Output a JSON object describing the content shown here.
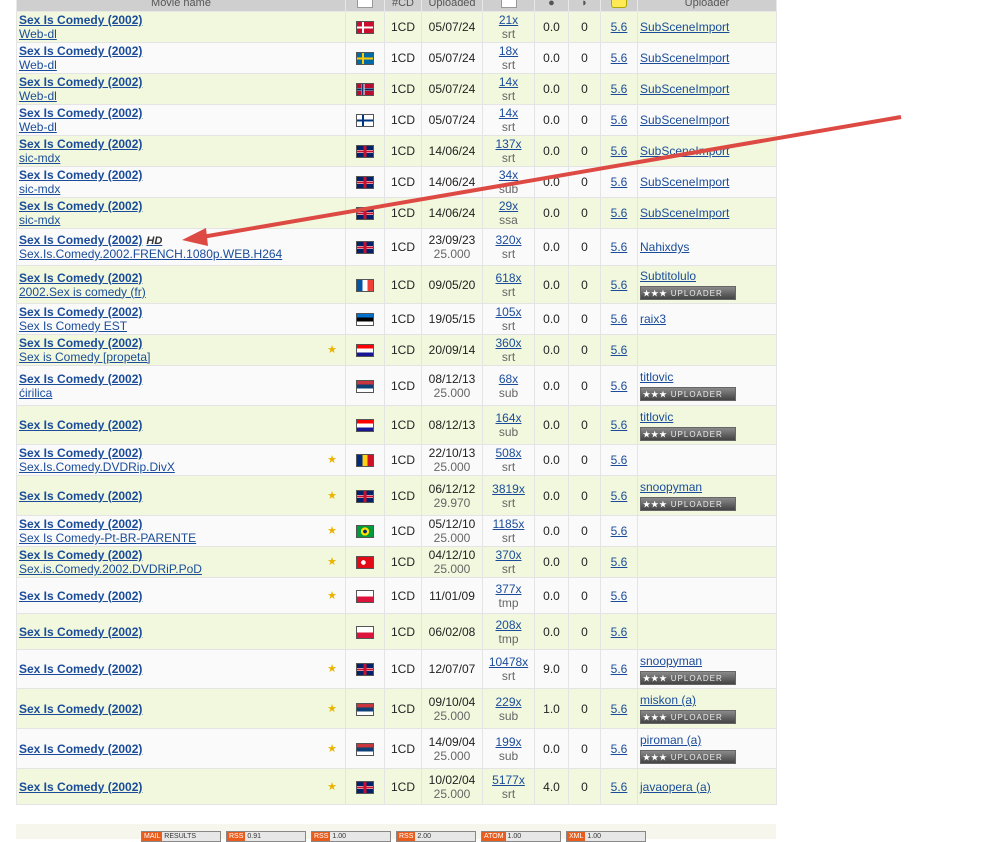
{
  "headers": {
    "movie_name": "Movie name",
    "cd": "#CD",
    "uploaded": "Uploaded",
    "uploader": "Uploader"
  },
  "badge": {
    "stars": "★★★",
    "label": "UPLOADER"
  },
  "hd_label": "HD",
  "star_glyph": "★",
  "rows": [
    {
      "title": "Sex Is Comedy (2002)",
      "release": "Web-dl",
      "flag": "dk",
      "cd": "1CD",
      "date": "05/07/24",
      "fps": "",
      "dl": "21x",
      "fmt": "srt",
      "rating": "0.0",
      "votes": "0",
      "imdb": "5.6",
      "uploader": "SubSceneImport",
      "badge": false,
      "star": false,
      "hd": false
    },
    {
      "title": "Sex Is Comedy (2002)",
      "release": "Web-dl",
      "flag": "se",
      "cd": "1CD",
      "date": "05/07/24",
      "fps": "",
      "dl": "18x",
      "fmt": "srt",
      "rating": "0.0",
      "votes": "0",
      "imdb": "5.6",
      "uploader": "SubSceneImport",
      "badge": false,
      "star": false,
      "hd": false
    },
    {
      "title": "Sex Is Comedy (2002)",
      "release": "Web-dl",
      "flag": "no",
      "cd": "1CD",
      "date": "05/07/24",
      "fps": "",
      "dl": "14x",
      "fmt": "srt",
      "rating": "0.0",
      "votes": "0",
      "imdb": "5.6",
      "uploader": "SubSceneImport",
      "badge": false,
      "star": false,
      "hd": false
    },
    {
      "title": "Sex Is Comedy (2002)",
      "release": "Web-dl",
      "flag": "fi",
      "cd": "1CD",
      "date": "05/07/24",
      "fps": "",
      "dl": "14x",
      "fmt": "srt",
      "rating": "0.0",
      "votes": "0",
      "imdb": "5.6",
      "uploader": "SubSceneImport",
      "badge": false,
      "star": false,
      "hd": false
    },
    {
      "title": "Sex Is Comedy (2002)",
      "release": "sic-mdx",
      "flag": "gb",
      "cd": "1CD",
      "date": "14/06/24",
      "fps": "",
      "dl": "137x",
      "fmt": "srt",
      "rating": "0.0",
      "votes": "0",
      "imdb": "5.6",
      "uploader": "SubSceneImport",
      "badge": false,
      "star": false,
      "hd": false
    },
    {
      "title": "Sex Is Comedy (2002)",
      "release": "sic-mdx",
      "flag": "gb",
      "cd": "1CD",
      "date": "14/06/24",
      "fps": "",
      "dl": "34x",
      "fmt": "sub",
      "rating": "0.0",
      "votes": "0",
      "imdb": "5.6",
      "uploader": "SubSceneImport",
      "badge": false,
      "star": false,
      "hd": false
    },
    {
      "title": "Sex Is Comedy (2002)",
      "release": "sic-mdx",
      "flag": "gb",
      "cd": "1CD",
      "date": "14/06/24",
      "fps": "",
      "dl": "29x",
      "fmt": "ssa",
      "rating": "0.0",
      "votes": "0",
      "imdb": "5.6",
      "uploader": "SubSceneImport",
      "badge": false,
      "star": false,
      "hd": false
    },
    {
      "title": "Sex Is Comedy (2002)",
      "release": "Sex.Is.Comedy.2002.FRENCH.1080p.WEB.H264",
      "flag": "gb",
      "cd": "1CD",
      "date": "23/09/23",
      "fps": "25.000",
      "dl": "320x",
      "fmt": "srt",
      "rating": "0.0",
      "votes": "0",
      "imdb": "5.6",
      "uploader": "Nahixdys",
      "badge": false,
      "star": false,
      "hd": true
    },
    {
      "title": "Sex Is Comedy (2002)",
      "release": "2002.Sex is comedy (fr)",
      "flag": "fr",
      "cd": "1CD",
      "date": "09/05/20",
      "fps": "",
      "dl": "618x",
      "fmt": "srt",
      "rating": "0.0",
      "votes": "0",
      "imdb": "5.6",
      "uploader": "Subtitolulo",
      "badge": true,
      "star": false,
      "hd": false
    },
    {
      "title": "Sex Is Comedy (2002)",
      "release": "Sex Is Comedy EST",
      "flag": "ee",
      "cd": "1CD",
      "date": "19/05/15",
      "fps": "",
      "dl": "105x",
      "fmt": "srt",
      "rating": "0.0",
      "votes": "0",
      "imdb": "5.6",
      "uploader": "raix3",
      "badge": false,
      "star": false,
      "hd": false
    },
    {
      "title": "Sex Is Comedy (2002)",
      "release": "Sex is Comedy [propeta]",
      "flag": "hr",
      "cd": "1CD",
      "date": "20/09/14",
      "fps": "",
      "dl": "360x",
      "fmt": "srt",
      "rating": "0.0",
      "votes": "0",
      "imdb": "5.6",
      "uploader": "",
      "badge": false,
      "star": true,
      "hd": false
    },
    {
      "title": "Sex Is Comedy (2002)",
      "release": "ćirilica",
      "flag": "rs",
      "cd": "1CD",
      "date": "08/12/13",
      "fps": "25.000",
      "dl": "68x",
      "fmt": "sub",
      "rating": "0.0",
      "votes": "0",
      "imdb": "5.6",
      "uploader": "titlovic",
      "badge": true,
      "star": false,
      "hd": false
    },
    {
      "title": "Sex Is Comedy (2002)",
      "release": "",
      "flag": "hr",
      "cd": "1CD",
      "date": "08/12/13",
      "fps": "",
      "dl": "164x",
      "fmt": "sub",
      "rating": "0.0",
      "votes": "0",
      "imdb": "5.6",
      "uploader": "titlovic",
      "badge": true,
      "star": false,
      "hd": false
    },
    {
      "title": "Sex Is Comedy (2002)",
      "release": "Sex.Is.Comedy.DVDRip.DivX",
      "flag": "ro",
      "cd": "1CD",
      "date": "22/10/13",
      "fps": "25.000",
      "dl": "508x",
      "fmt": "srt",
      "rating": "0.0",
      "votes": "0",
      "imdb": "5.6",
      "uploader": "",
      "badge": false,
      "star": true,
      "hd": false
    },
    {
      "title": "Sex Is Comedy (2002)",
      "release": "",
      "flag": "gb",
      "cd": "1CD",
      "date": "06/12/12",
      "fps": "29.970",
      "dl": "3819x",
      "fmt": "srt",
      "rating": "0.0",
      "votes": "0",
      "imdb": "5.6",
      "uploader": "snoopyman",
      "badge": true,
      "star": true,
      "hd": false
    },
    {
      "title": "Sex Is Comedy (2002)",
      "release": "Sex Is Comedy-Pt-BR-PARENTE",
      "flag": "br",
      "cd": "1CD",
      "date": "05/12/10",
      "fps": "25.000",
      "dl": "1185x",
      "fmt": "srt",
      "rating": "0.0",
      "votes": "0",
      "imdb": "5.6",
      "uploader": "",
      "badge": false,
      "star": true,
      "hd": false
    },
    {
      "title": "Sex Is Comedy (2002)",
      "release": "Sex.is.Comedy.2002.DVDRiP.PoD",
      "flag": "tr",
      "cd": "1CD",
      "date": "04/12/10",
      "fps": "25.000",
      "dl": "370x",
      "fmt": "srt",
      "rating": "0.0",
      "votes": "0",
      "imdb": "5.6",
      "uploader": "",
      "badge": false,
      "star": true,
      "hd": false
    },
    {
      "title": "Sex Is Comedy (2002)",
      "release": "",
      "flag": "pl",
      "cd": "1CD",
      "date": "11/01/09",
      "fps": "",
      "dl": "377x",
      "fmt": "tmp",
      "rating": "0.0",
      "votes": "0",
      "imdb": "5.6",
      "uploader": "",
      "badge": false,
      "star": true,
      "hd": false
    },
    {
      "title": "Sex Is Comedy (2002)",
      "release": "",
      "flag": "pl",
      "cd": "1CD",
      "date": "06/02/08",
      "fps": "",
      "dl": "208x",
      "fmt": "tmp",
      "rating": "0.0",
      "votes": "0",
      "imdb": "5.6",
      "uploader": "",
      "badge": false,
      "star": false,
      "hd": false
    },
    {
      "title": "Sex Is Comedy (2002)",
      "release": "",
      "flag": "gb",
      "cd": "1CD",
      "date": "12/07/07",
      "fps": "",
      "dl": "10478x",
      "fmt": "srt",
      "rating": "9.0",
      "votes": "0",
      "imdb": "5.6",
      "uploader": "snoopyman",
      "badge": true,
      "star": true,
      "hd": false
    },
    {
      "title": "Sex Is Comedy (2002)",
      "release": "",
      "flag": "rs",
      "cd": "1CD",
      "date": "09/10/04",
      "fps": "25.000",
      "dl": "229x",
      "fmt": "sub",
      "rating": "1.0",
      "votes": "0",
      "imdb": "5.6",
      "uploader": "miskon (a)",
      "badge": true,
      "star": true,
      "hd": false
    },
    {
      "title": "Sex Is Comedy (2002)",
      "release": "",
      "flag": "rs",
      "cd": "1CD",
      "date": "14/09/04",
      "fps": "25.000",
      "dl": "199x",
      "fmt": "sub",
      "rating": "0.0",
      "votes": "0",
      "imdb": "5.6",
      "uploader": "piroman (a)",
      "badge": true,
      "star": true,
      "hd": false
    },
    {
      "title": "Sex Is Comedy (2002)",
      "release": "",
      "flag": "gb",
      "cd": "1CD",
      "date": "10/02/04",
      "fps": "25.000",
      "dl": "5177x",
      "fmt": "srt",
      "rating": "4.0",
      "votes": "0",
      "imdb": "5.6",
      "uploader": "javaopera (a)",
      "badge": false,
      "star": true,
      "hd": false
    }
  ],
  "footer_buttons": [
    {
      "tag": "MAIL",
      "label": "RESULTS"
    },
    {
      "tag": "RSS",
      "label": "0.91"
    },
    {
      "tag": "RSS",
      "label": "1.00"
    },
    {
      "tag": "RSS",
      "label": "2.00"
    },
    {
      "tag": "ATOM",
      "label": "1.00"
    },
    {
      "tag": "XML",
      "label": "1.00"
    }
  ],
  "colors": {
    "arrow": "#dd4a44",
    "row_odd": "#f1f8dd",
    "row_even": "#fafafa",
    "link": "#1a4c9a",
    "star": "#e9b400"
  }
}
